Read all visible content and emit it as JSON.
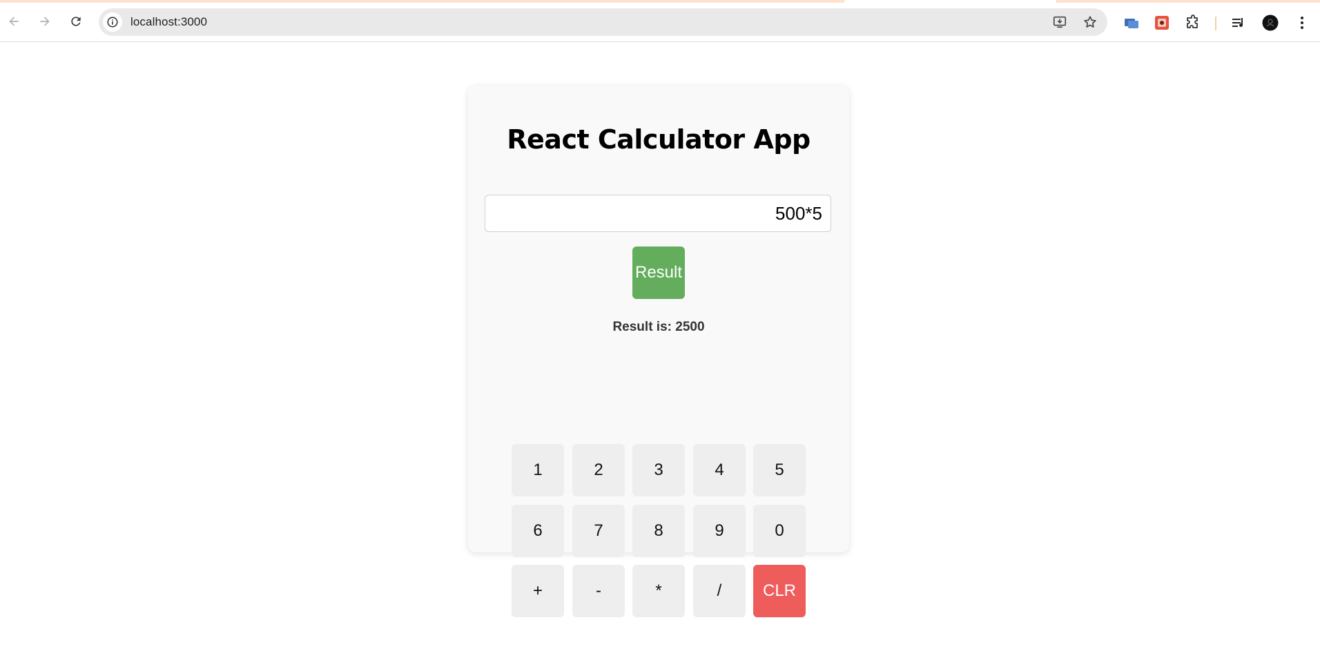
{
  "browser": {
    "url": "localhost:3000",
    "accent_color": "#fde3cf"
  },
  "app": {
    "title": "React Calculator App",
    "input_value": "500*5",
    "result_button_label": "Result",
    "result_text": "Result is: 2500",
    "colors": {
      "result_button": "#63ad5c",
      "clear_button": "#ef5c5c",
      "key_background": "#eeeeee",
      "card_background": "#f9f9f9"
    }
  },
  "keypad": {
    "keys": [
      "1",
      "2",
      "3",
      "4",
      "5",
      "6",
      "7",
      "8",
      "9",
      "0",
      "+",
      "-",
      "*",
      "/",
      "CLR"
    ]
  },
  "icons": {
    "toolbar": [
      "back-arrow-icon",
      "forward-arrow-icon",
      "reload-icon",
      "site-info-icon",
      "install-app-icon",
      "bookmark-star-icon",
      "extension-window-icon",
      "extension-puzzle-red-icon",
      "extensions-puzzle-icon",
      "media-queue-icon",
      "profile-avatar-icon",
      "more-menu-icon"
    ]
  }
}
